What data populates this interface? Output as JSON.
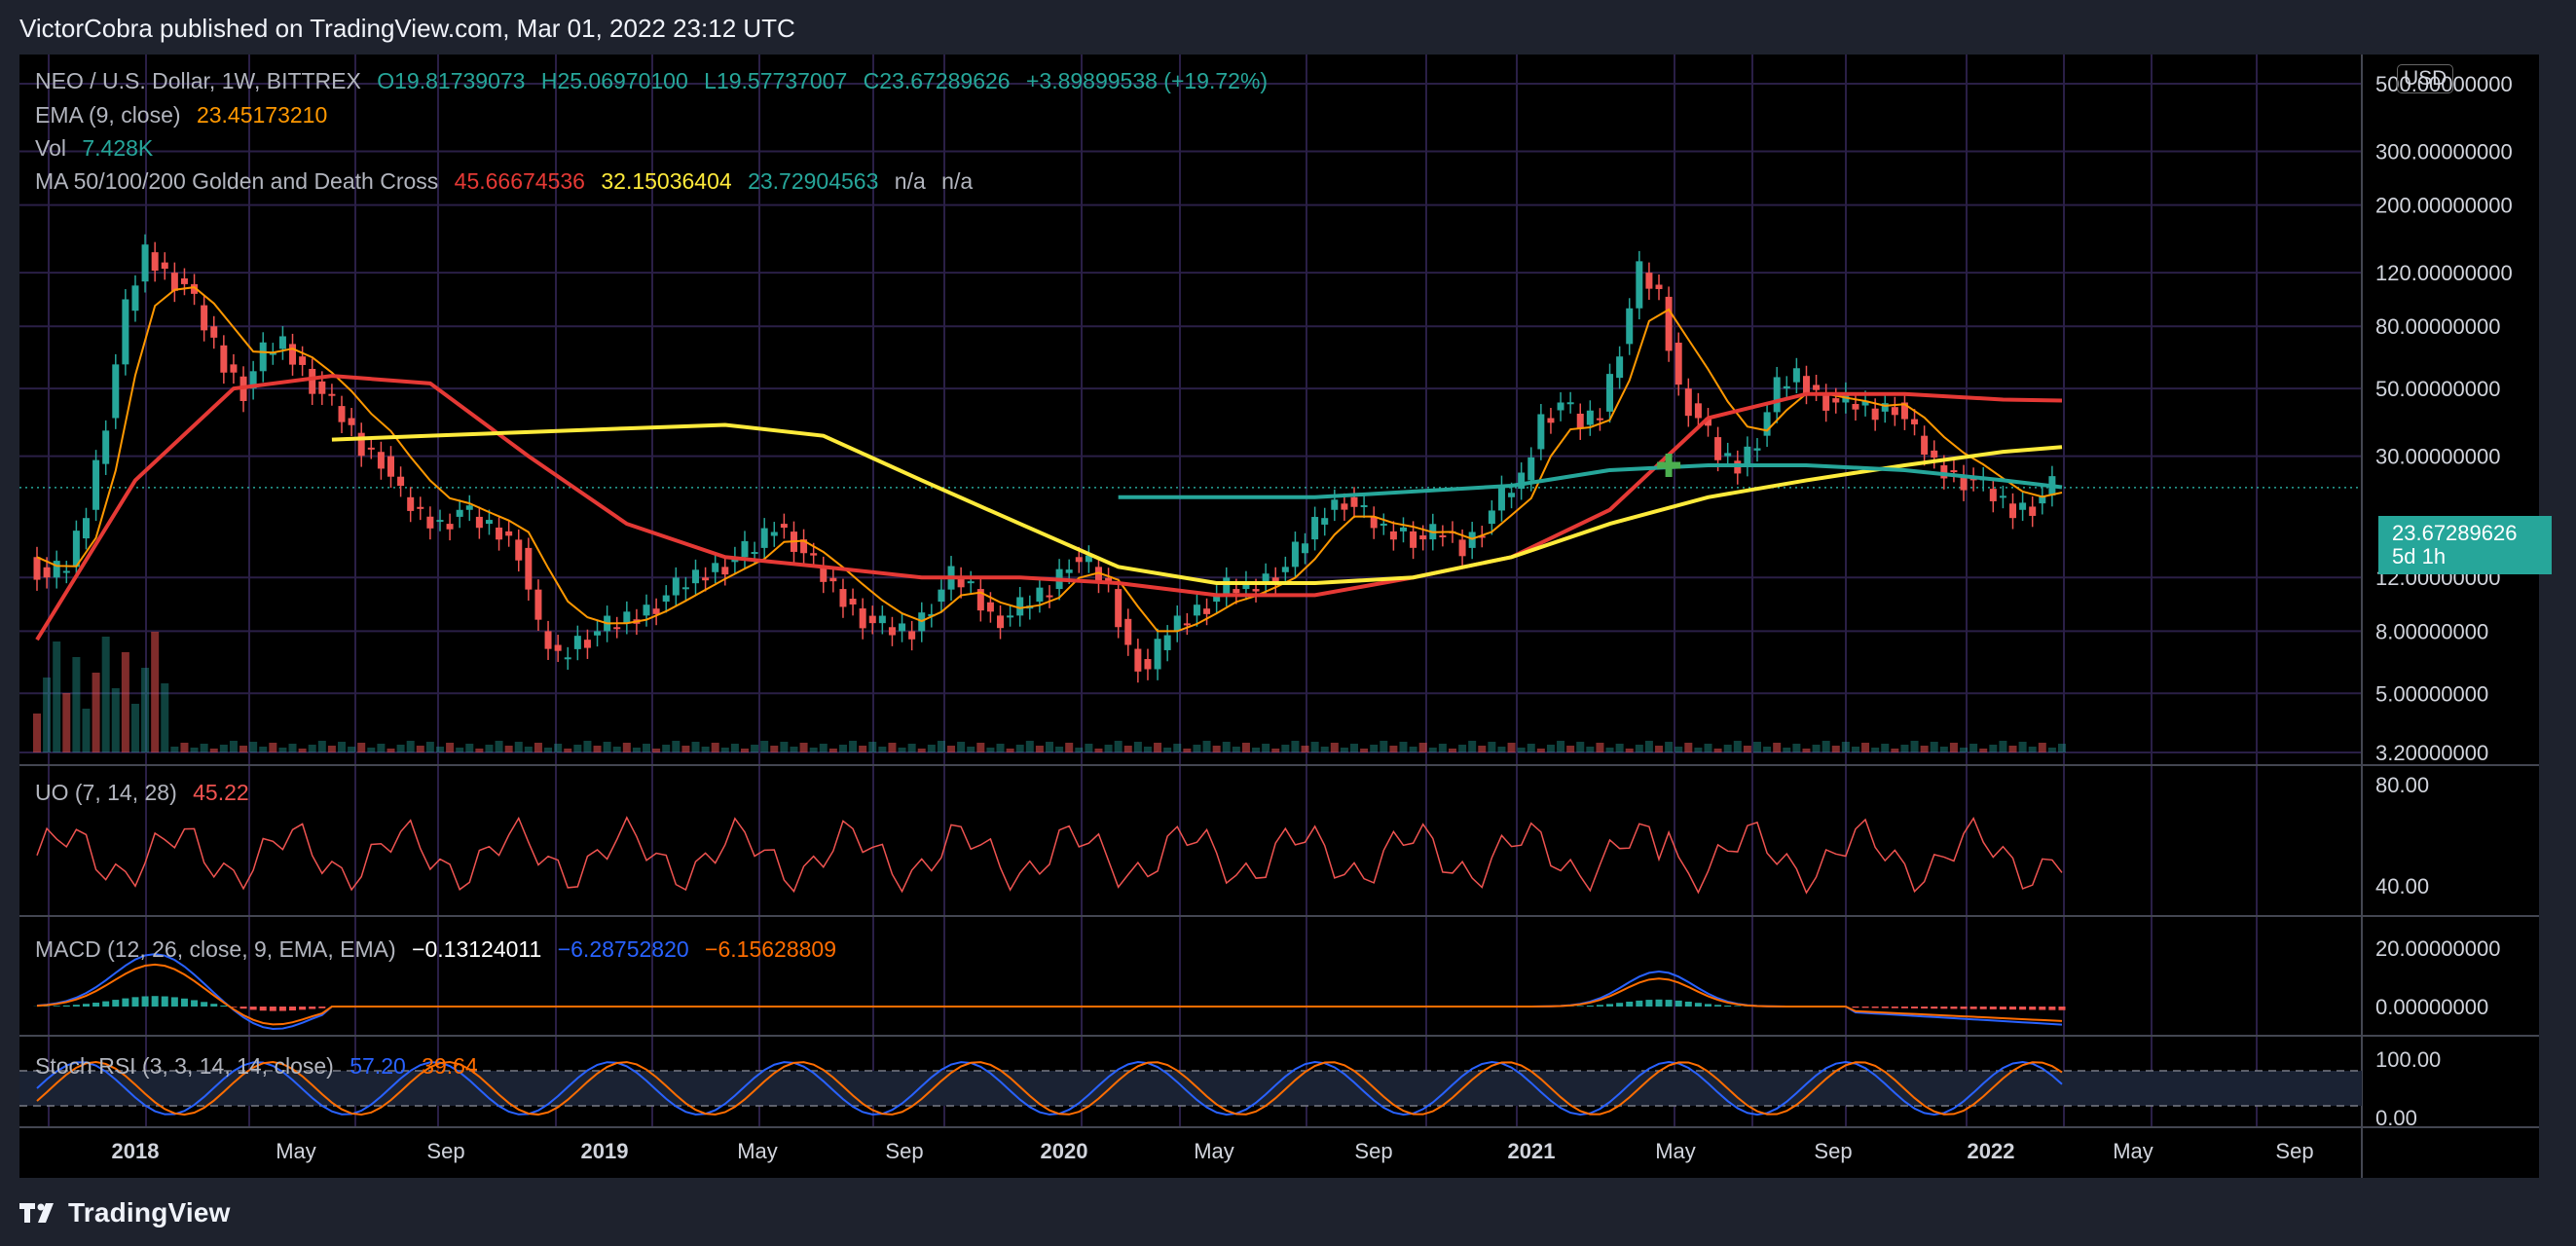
{
  "header": {
    "attribution": "VictorCobra published on TradingView.com, Mar 01, 2022 23:12 UTC"
  },
  "footer": {
    "brand": "TradingView"
  },
  "colors": {
    "up": "#26a69a",
    "down": "#ef5350",
    "ema": "#ff9800",
    "ma50": "#e53935",
    "ma100": "#ffeb3b",
    "ma200": "#26a69a",
    "uo": "#ef5350",
    "macd": "#2962ff",
    "signal": "#ff6d00",
    "stoch_k": "#2962ff",
    "stoch_d": "#ff6d00"
  },
  "legend": {
    "symbol": "NEO / U.S. Dollar, 1W, BITTREX",
    "open": "O19.81739073",
    "high": "H25.06970100",
    "low": "L19.57737007",
    "close": "C23.67289626",
    "change": "+3.89899538 (+19.72%)",
    "ema_label": "EMA (9, close)",
    "ema_value": "23.45173210",
    "vol_label": "Vol",
    "vol_value": "7.428K",
    "ma_label": "MA 50/100/200 Golden and Death Cross",
    "ma50_value": "45.66674536",
    "ma100_value": "32.15036404",
    "ma200_value": "23.72904563",
    "na1": "n/a",
    "na2": "n/a",
    "uo_label": "UO (7, 14, 28)",
    "uo_value": "45.22",
    "macd_label": "MACD (12, 26, close, 9, EMA, EMA)",
    "macd_hist": "−0.13124011",
    "macd_line": "−6.28752820",
    "macd_signal": "−6.15628809",
    "stoch_label": "Stoch RSI (3, 3, 14, 14, close)",
    "stoch_k": "57.20",
    "stoch_d": "39.64"
  },
  "price_axis": {
    "currency": "USD",
    "ticks": [
      "500.00000000",
      "300.00000000",
      "200.00000000",
      "120.00000000",
      "80.00000000",
      "50.00000000",
      "30.00000000",
      "12.00000000",
      "8.00000000",
      "5.00000000",
      "3.20000000"
    ],
    "last_price": "23.67289626",
    "countdown": "5d 1h"
  },
  "uo_axis": {
    "ticks": [
      "80.00",
      "40.00"
    ]
  },
  "macd_axis": {
    "ticks": [
      "20.00000000",
      "0.00000000"
    ]
  },
  "stoch_axis": {
    "ticks": [
      "100.00",
      "0.00"
    ]
  },
  "time_axis": {
    "ticks": [
      "2018",
      "May",
      "Sep",
      "2019",
      "May",
      "Sep",
      "2020",
      "May",
      "Sep",
      "2021",
      "May",
      "Sep",
      "2022",
      "May",
      "Sep"
    ]
  },
  "chart_data": {
    "type": "candlestick",
    "timeframe": "1W",
    "y_scale": "log",
    "ylim": [
      3.2,
      500
    ],
    "x_start": "2017-09",
    "x_end": "2022-10",
    "price_path": [
      [
        0,
        14
      ],
      [
        2,
        12
      ],
      [
        4,
        13
      ],
      [
        6,
        20
      ],
      [
        8,
        40
      ],
      [
        10,
        90
      ],
      [
        12,
        140
      ],
      [
        14,
        120
      ],
      [
        16,
        110
      ],
      [
        18,
        80
      ],
      [
        20,
        60
      ],
      [
        22,
        50
      ],
      [
        24,
        65
      ],
      [
        26,
        70
      ],
      [
        28,
        58
      ],
      [
        30,
        48
      ],
      [
        32,
        40
      ],
      [
        34,
        32
      ],
      [
        36,
        30
      ],
      [
        38,
        22
      ],
      [
        40,
        19
      ],
      [
        42,
        18
      ],
      [
        44,
        20
      ],
      [
        46,
        18
      ],
      [
        48,
        17
      ],
      [
        50,
        15
      ],
      [
        52,
        8
      ],
      [
        54,
        6.5
      ],
      [
        56,
        7.5
      ],
      [
        58,
        8
      ],
      [
        60,
        8.5
      ],
      [
        62,
        9
      ],
      [
        64,
        10
      ],
      [
        66,
        11
      ],
      [
        68,
        12
      ],
      [
        70,
        13
      ],
      [
        72,
        14
      ],
      [
        74,
        15
      ],
      [
        76,
        18
      ],
      [
        78,
        16
      ],
      [
        80,
        13
      ],
      [
        82,
        11
      ],
      [
        84,
        9.5
      ],
      [
        86,
        8.5
      ],
      [
        88,
        8
      ],
      [
        90,
        8
      ],
      [
        92,
        10
      ],
      [
        94,
        12
      ],
      [
        96,
        11
      ],
      [
        98,
        9
      ],
      [
        100,
        9
      ],
      [
        102,
        10
      ],
      [
        104,
        11
      ],
      [
        106,
        14
      ],
      [
        108,
        13
      ],
      [
        110,
        11
      ],
      [
        112,
        7
      ],
      [
        114,
        6
      ],
      [
        116,
        8
      ],
      [
        118,
        9
      ],
      [
        120,
        10
      ],
      [
        122,
        11
      ],
      [
        124,
        11
      ],
      [
        126,
        12
      ],
      [
        128,
        13
      ],
      [
        130,
        16
      ],
      [
        132,
        20
      ],
      [
        134,
        22
      ],
      [
        136,
        19
      ],
      [
        138,
        17
      ],
      [
        140,
        17
      ],
      [
        142,
        16
      ],
      [
        144,
        17
      ],
      [
        146,
        15
      ],
      [
        148,
        18
      ],
      [
        150,
        22
      ],
      [
        152,
        25
      ],
      [
        154,
        40
      ],
      [
        156,
        45
      ],
      [
        158,
        38
      ],
      [
        160,
        42
      ],
      [
        162,
        70
      ],
      [
        164,
        120
      ],
      [
        166,
        100
      ],
      [
        168,
        50
      ],
      [
        170,
        40
      ],
      [
        172,
        30
      ],
      [
        174,
        28
      ],
      [
        176,
        35
      ],
      [
        178,
        50
      ],
      [
        180,
        55
      ],
      [
        182,
        48
      ],
      [
        184,
        45
      ],
      [
        186,
        44
      ],
      [
        188,
        42
      ],
      [
        190,
        45
      ],
      [
        192,
        35
      ],
      [
        194,
        28
      ],
      [
        196,
        26
      ],
      [
        198,
        25
      ],
      [
        200,
        22
      ],
      [
        202,
        20
      ],
      [
        204,
        21
      ],
      [
        206,
        23.67
      ]
    ],
    "ema9": "orange line tracking price",
    "ma50": [
      [
        0,
        7.5
      ],
      [
        10,
        25
      ],
      [
        20,
        50
      ],
      [
        30,
        55
      ],
      [
        40,
        52
      ],
      [
        50,
        30
      ],
      [
        60,
        18
      ],
      [
        70,
        14
      ],
      [
        80,
        13
      ],
      [
        90,
        12
      ],
      [
        100,
        12
      ],
      [
        110,
        11.5
      ],
      [
        120,
        10.5
      ],
      [
        130,
        10.5
      ],
      [
        140,
        12
      ],
      [
        150,
        14
      ],
      [
        160,
        20
      ],
      [
        170,
        40
      ],
      [
        180,
        48
      ],
      [
        190,
        48
      ],
      [
        200,
        46
      ],
      [
        206,
        45.67
      ]
    ],
    "ma100": [
      [
        30,
        34
      ],
      [
        40,
        35
      ],
      [
        50,
        36
      ],
      [
        60,
        37
      ],
      [
        70,
        38
      ],
      [
        80,
        35
      ],
      [
        90,
        25
      ],
      [
        100,
        18
      ],
      [
        110,
        13
      ],
      [
        120,
        11.5
      ],
      [
        130,
        11.5
      ],
      [
        140,
        12
      ],
      [
        150,
        14
      ],
      [
        160,
        18
      ],
      [
        170,
        22
      ],
      [
        180,
        25
      ],
      [
        190,
        28
      ],
      [
        200,
        31
      ],
      [
        206,
        32.15
      ]
    ],
    "ma200": [
      [
        110,
        22
      ],
      [
        130,
        22
      ],
      [
        150,
        24
      ],
      [
        160,
        27
      ],
      [
        170,
        28
      ],
      [
        180,
        28
      ],
      [
        190,
        27
      ],
      [
        200,
        25
      ],
      [
        206,
        23.73
      ]
    ],
    "golden_cross_marker": {
      "week": 166,
      "price": 28
    },
    "indicators": {
      "uo": {
        "last": 45.22,
        "ylim": [
          30,
          80
        ]
      },
      "macd": {
        "macd": -6.2875282,
        "signal": -6.15628809,
        "hist": -0.13124011
      },
      "stoch_rsi": {
        "k": 57.2,
        "d": 39.64,
        "ylim": [
          0,
          100
        ]
      }
    }
  }
}
